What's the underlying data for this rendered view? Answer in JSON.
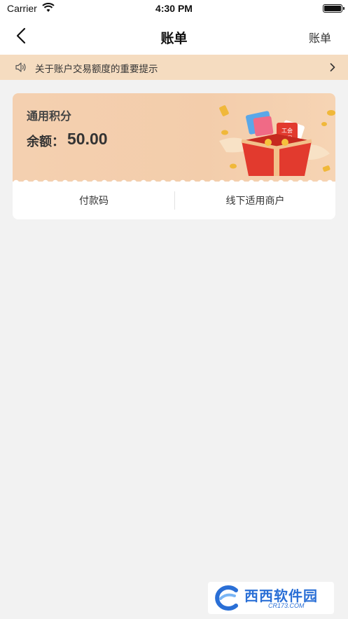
{
  "status_bar": {
    "carrier": "Carrier",
    "time": "4:30 PM"
  },
  "nav": {
    "title": "账单",
    "right_label": "账单"
  },
  "notice": {
    "text": "关于账户交易额度的重要提示"
  },
  "card": {
    "title": "通用积分",
    "balance_label": "余额：",
    "balance_value": "50.00",
    "gift_label": "工会会员",
    "actions": {
      "pay_code": "付款码",
      "merchants": "线下适用商户"
    }
  },
  "watermark": {
    "text": "西西软件园",
    "sub": "CR173.COM"
  },
  "colors": {
    "background": "#f2f2f2",
    "notice_bg": "#f5dcc0",
    "card_top": "#f3cdab",
    "gift_red": "#e23a2e",
    "watermark_blue": "#2a6fd6"
  }
}
